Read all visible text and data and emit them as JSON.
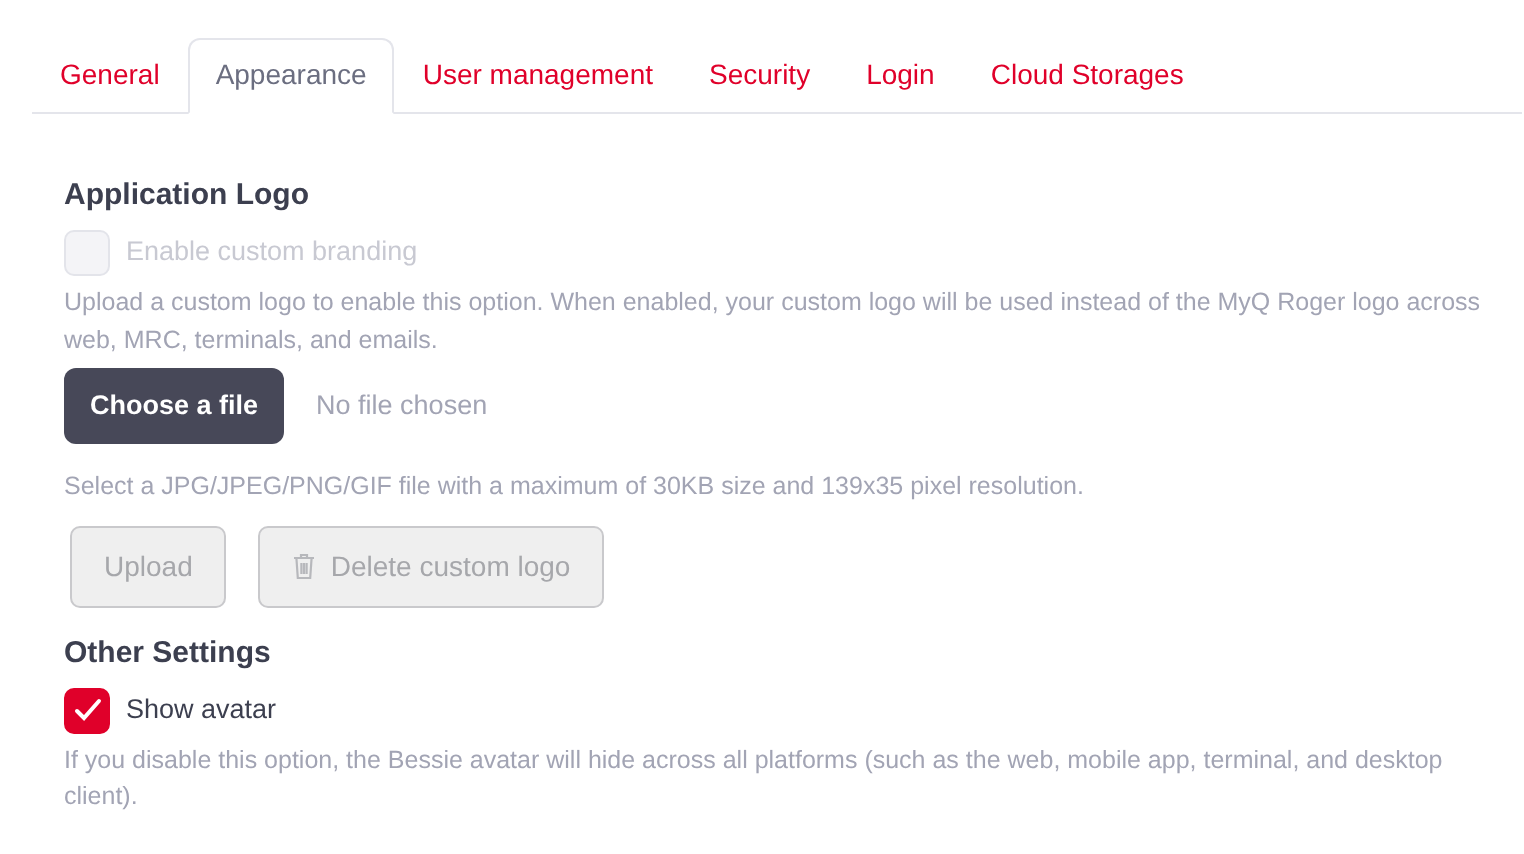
{
  "tabs": [
    {
      "label": "General",
      "selected": false
    },
    {
      "label": "Appearance",
      "selected": true
    },
    {
      "label": "User management",
      "selected": false
    },
    {
      "label": "Security",
      "selected": false
    },
    {
      "label": "Login",
      "selected": false
    },
    {
      "label": "Cloud Storages",
      "selected": false
    }
  ],
  "application_logo": {
    "title": "Application Logo",
    "branding": {
      "label": "Enable custom branding",
      "checked": false,
      "disabled": true
    },
    "help": "Upload a custom logo to enable this option. When enabled, your custom logo will be used instead of the MyQ Roger logo across web, MRC, terminals, and emails.",
    "file": {
      "button": "Choose a file",
      "status": "No file chosen"
    },
    "file_hint": "Select a JPG/JPEG/PNG/GIF file with a maximum of 30KB size and 139x35 pixel resolution.",
    "buttons": [
      {
        "label": "Upload",
        "disabled": true
      },
      {
        "label": "Delete custom logo",
        "kind": "trash",
        "disabled": true
      }
    ]
  },
  "other_settings": {
    "title": "Other Settings",
    "avatar": {
      "label": "Show avatar",
      "checked": true,
      "disabled": false
    },
    "help": "If you disable this option, the Bessie avatar will hide across all platforms (such as the web, mobile app, terminal, and desktop client)."
  }
}
